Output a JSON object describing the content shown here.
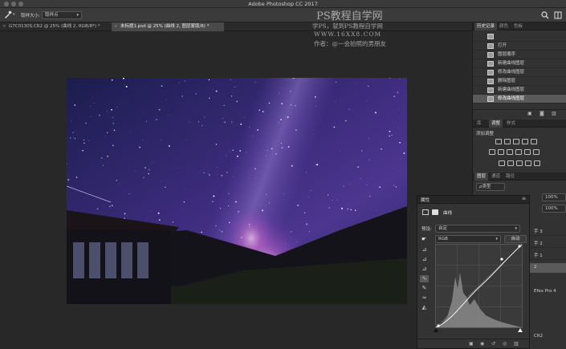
{
  "title_bar": {
    "app_title": "Adobe Photoshop CC 2017"
  },
  "options_bar": {
    "sample_size_label": "取样大小:",
    "sample_size_value": "取样点"
  },
  "document_tabs": [
    {
      "label": "G7C0130S.CR2 @ 25% (曲线 2, RGB/8*) *",
      "active": false
    },
    {
      "label": "未标题1.psd @ 25% (曲线 2, 图层蒙版/8) *",
      "active": true
    }
  ],
  "watermark": {
    "line1": "PS教程自学网",
    "line2": "学PS，就到PS教程自学网",
    "line3": "WWW.16XX8.COM",
    "line4": "作者：@一会拍照的男朋友"
  },
  "history_panel": {
    "tabs": [
      "历史记录",
      "颜色",
      "色板"
    ],
    "active_tab": 0,
    "items": [
      "打开",
      "图层顺序",
      "新建曲线图层",
      "修改曲线图层",
      "删除图层",
      "新建曲线图层",
      "修改曲线图层"
    ],
    "selected_index": 6
  },
  "adjustments_panel": {
    "tabs": [
      "库",
      "调整",
      "样式"
    ],
    "active_tab": 1,
    "add_adjustment_label": "添加调整"
  },
  "layers_panel": {
    "tabs": [
      "图层",
      "通道",
      "路径"
    ],
    "active_tab": 0,
    "kind_filter": "ρ类型",
    "opacity_value": "100%",
    "fill_value": "100%",
    "layer_labels": [
      "手 3",
      "手 2",
      "手 1",
      "2",
      "Efex Pro 4",
      "CR2"
    ]
  },
  "properties_panel": {
    "title": "属性",
    "adjustment_name": "曲线",
    "preset_label": "预设:",
    "preset_value": "自定",
    "channel_value": "RGB",
    "auto_button": "自动"
  },
  "colors": {
    "accent_curve": "#ffffff",
    "panel_bg": "#323232",
    "workspace_bg": "#282828"
  }
}
